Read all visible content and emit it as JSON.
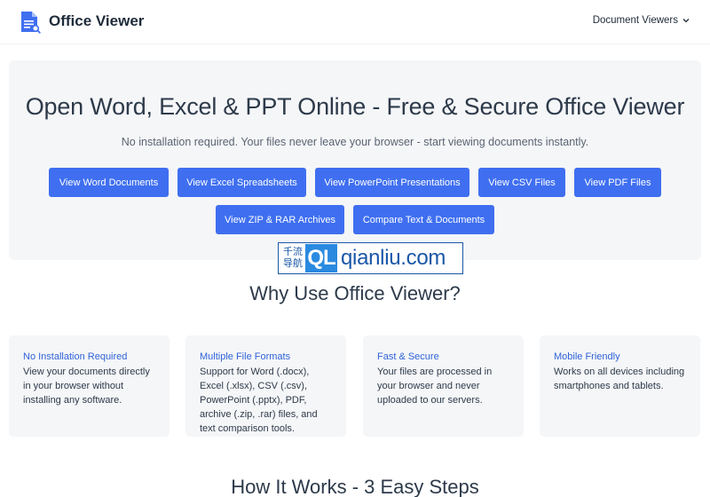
{
  "header": {
    "brand": "Office Viewer",
    "nav_dropdown": "Document Viewers"
  },
  "hero": {
    "title": "Open Word, Excel & PPT Online - Free & Secure Office Viewer",
    "subtitle": "No installation required. Your files never leave your browser - start viewing documents instantly.",
    "buttons": [
      "View Word Documents",
      "View Excel Spreadsheets",
      "View PowerPoint Presentations",
      "View CSV Files",
      "View PDF Files",
      "View ZIP & RAR Archives",
      "Compare Text & Documents"
    ]
  },
  "watermark": {
    "cn_line1": "千流",
    "cn_line2": "导航",
    "badge": "QL",
    "site": "qianliu.com"
  },
  "why": {
    "title": "Why Use Office Viewer?",
    "features": [
      {
        "title": "No Installation Required",
        "text": "View your documents directly in your browser without installing any software."
      },
      {
        "title": "Multiple File Formats",
        "text": "Support for Word (.docx), Excel (.xlsx), CSV (.csv), PowerPoint (.pptx), PDF, archive (.zip, .rar) files, and text comparison tools."
      },
      {
        "title": "Fast & Secure",
        "text": "Your files are processed in your browser and never uploaded to our servers."
      },
      {
        "title": "Mobile Friendly",
        "text": "Works on all devices including smartphones and tablets."
      }
    ]
  },
  "how": {
    "title": "How It Works - 3 Easy Steps"
  },
  "colors": {
    "accent": "#3f6ff0",
    "link": "#2f63d9",
    "panel": "#f5f6f8",
    "text": "#2d3a4a"
  },
  "icons": {
    "logo": "document-search-icon",
    "dropdown": "chevron-down-icon"
  }
}
